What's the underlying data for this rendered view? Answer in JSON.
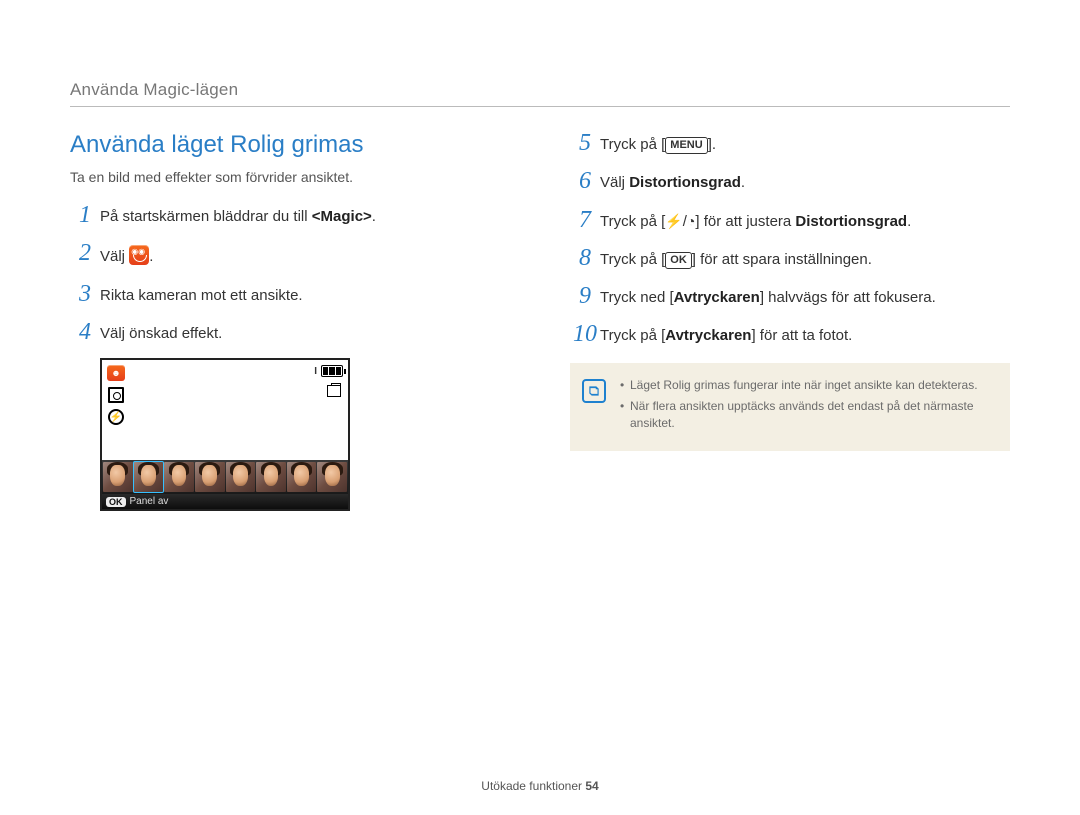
{
  "header": "Använda Magic-lägen",
  "section_title": "Använda läget Rolig grimas",
  "lead": "Ta en bild med effekter som förvrider ansiktet.",
  "step1_a": "På startskärmen bläddrar du till ",
  "step1_b": "<Magic>",
  "step1_c": ".",
  "step2_a": "Välj ",
  "step2_b": ".",
  "step3": "Rikta kameran mot ett ansikte.",
  "step4": "Välj önskad effekt.",
  "step5_a": "Tryck på [",
  "step5_b": "MENU",
  "step5_c": "].",
  "step6_a": "Välj ",
  "step6_b": "Distortionsgrad",
  "step6_c": ".",
  "step7_a": "Tryck på [",
  "step7_flash": "⚡",
  "step7_slash": "/",
  "step7_timer": "◔",
  "step7_b": "] för att justera ",
  "step7_c": "Distortionsgrad",
  "step7_d": ".",
  "step8_a": "Tryck på [",
  "step8_ok": "OK",
  "step8_b": "] för att spara inställningen.",
  "step9_a": "Tryck ned [",
  "step9_b": "Avtryckaren",
  "step9_c": "] halvvägs för att fokusera.",
  "step10_a": "Tryck på [",
  "step10_b": "Avtryckaren",
  "step10_c": "] för att ta fotot.",
  "note1": "Läget Rolig grimas fungerar inte när inget ansikte kan detekteras.",
  "note2": "När flera ansikten upptäcks används det endast på det närmaste ansiktet.",
  "lcd": {
    "ok": "OK",
    "panel": "Panel av",
    "batt": "I"
  },
  "footer_a": "Utökade funktioner  ",
  "footer_b": "54",
  "nums": [
    "1",
    "2",
    "3",
    "4",
    "5",
    "6",
    "7",
    "8",
    "9",
    "10"
  ]
}
